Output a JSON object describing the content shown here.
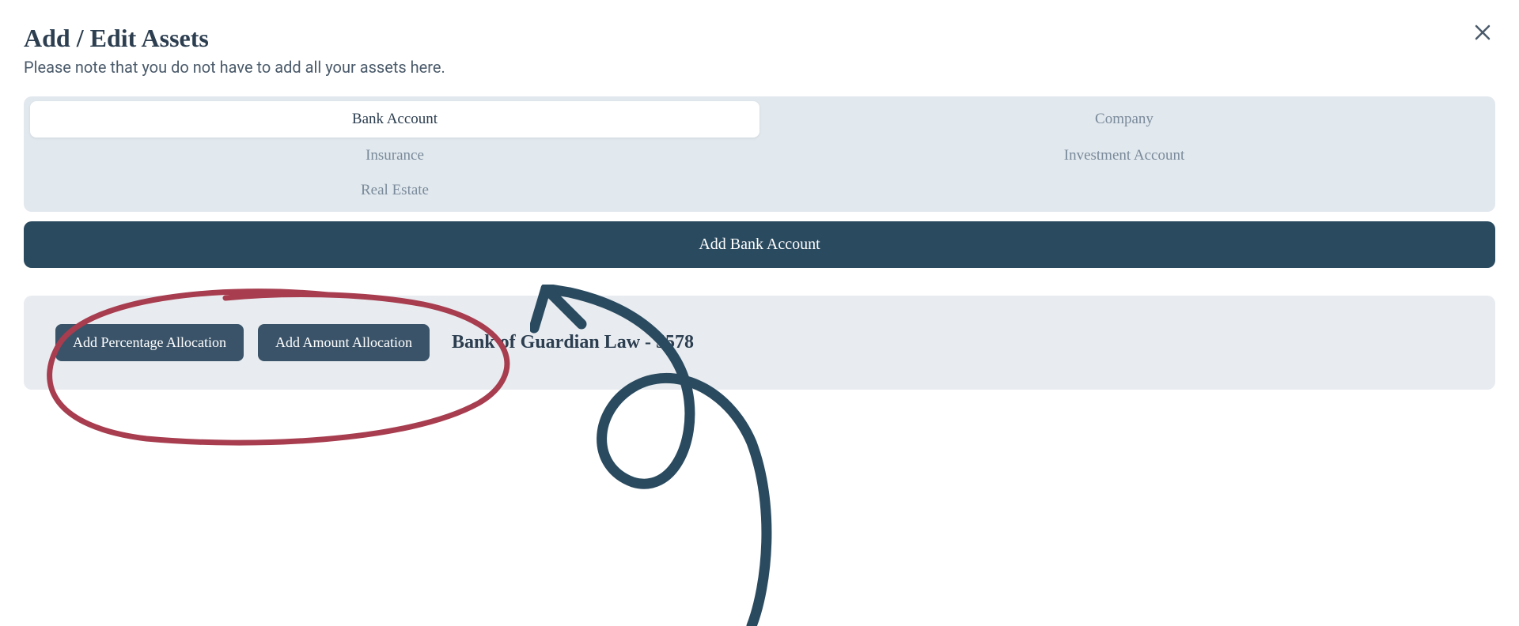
{
  "header": {
    "title": "Add / Edit Assets",
    "subtitle": "Please note that you do not have to add all your assets here."
  },
  "tabs": {
    "row1": [
      {
        "label": "Bank Account",
        "active": true
      },
      {
        "label": "Company",
        "active": false
      }
    ],
    "row2": [
      {
        "label": "Insurance",
        "active": false
      },
      {
        "label": "Investment Account",
        "active": false
      }
    ],
    "row3": [
      {
        "label": "Real Estate",
        "active": false
      }
    ]
  },
  "addButton": {
    "label": "Add Bank Account"
  },
  "accountCard": {
    "percentageBtn": "Add Percentage Allocation",
    "amountBtn": "Add Amount Allocation",
    "accountName": "Bank of Guardian Law - 5578"
  },
  "annotations": {
    "circleColor": "#a73d4f",
    "arrowColor": "#2a4a5f"
  }
}
